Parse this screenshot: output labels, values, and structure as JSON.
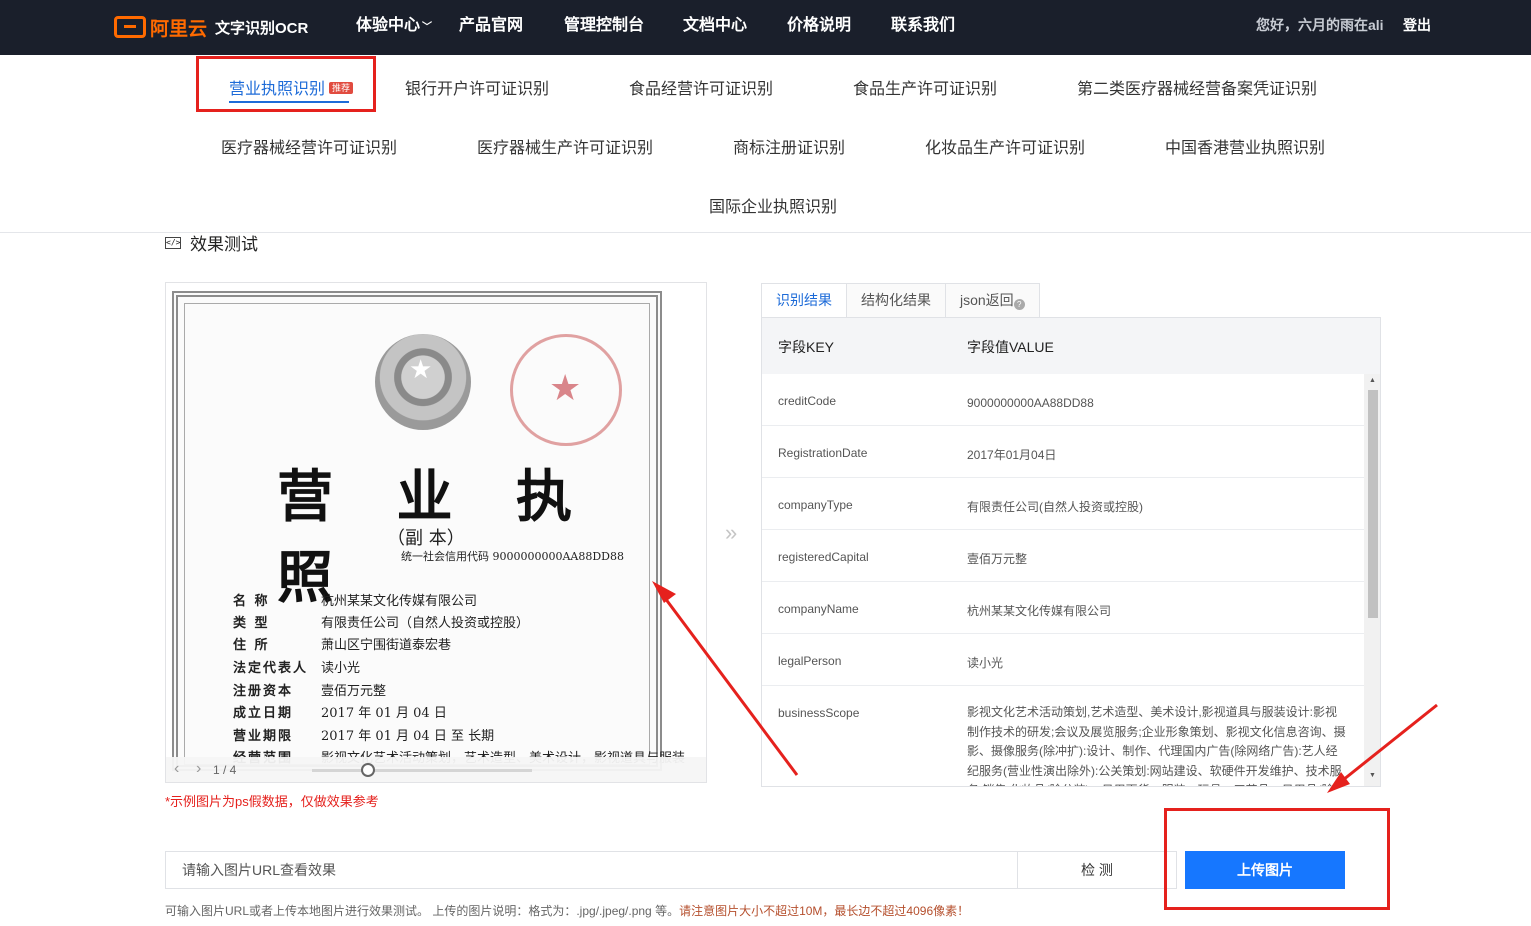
{
  "header": {
    "brand": "阿里云",
    "product": "文字识别OCR",
    "nav": [
      "体验中心",
      "产品官网",
      "管理控制台",
      "文档中心",
      "价格说明",
      "联系我们"
    ],
    "greeting": "您好，六月的雨在ali",
    "logout": "登出"
  },
  "tabs": {
    "row1": [
      "营业执照识别",
      "银行开户许可证识别",
      "食品经营许可证识别",
      "食品生产许可证识别",
      "第二类医疗器械经营备案凭证识别"
    ],
    "row2": [
      "医疗器械经营许可证识别",
      "医疗器械生产许可证识别",
      "商标注册证识别",
      "化妆品生产许可证识别",
      "中国香港营业执照识别"
    ],
    "row3": [
      "国际企业执照识别"
    ],
    "badge": "推荐"
  },
  "section_title": "效果测试",
  "license": {
    "title": "营 业 执 照",
    "subtitle": "（副 本）",
    "code": "统一社会信用代码 9000000000AA88DD88",
    "rows": [
      {
        "label": "名 称",
        "value": "杭州某某文化传媒有限公司"
      },
      {
        "label": "类 型",
        "value": "有限责任公司（自然人投资或控股）"
      },
      {
        "label": "住 所",
        "value": "萧山区宁围街道泰宏巷"
      },
      {
        "label": "法定代表人",
        "value": "读小光"
      },
      {
        "label": "注册资本",
        "value": "壹佰万元整"
      },
      {
        "label": "成立日期",
        "value": "2017 年 01 月 04 日"
      },
      {
        "label": "营业期限",
        "value": "2017 年 01 月 04 日 至 长期"
      },
      {
        "label": "经营范围",
        "value": "影视文化艺术活动策划，艺术造型、美术设计，影视道具与服装"
      }
    ]
  },
  "pager": {
    "text": "1 / 4"
  },
  "sample_note": "*示例图片为ps假数据，仅做效果参考",
  "result_tabs": [
    "识别结果",
    "结构化结果",
    "json返回"
  ],
  "result": {
    "head_key": "字段KEY",
    "head_value": "字段值VALUE",
    "rows": [
      {
        "key": "creditCode",
        "value": "9000000000AA88DD88"
      },
      {
        "key": "RegistrationDate",
        "value": "2017年01月04日"
      },
      {
        "key": "companyType",
        "value": "有限责任公司(自然人投资或控股)"
      },
      {
        "key": "registeredCapital",
        "value": "壹佰万元整"
      },
      {
        "key": "companyName",
        "value": "杭州某某文化传媒有限公司"
      },
      {
        "key": "legalPerson",
        "value": "读小光"
      },
      {
        "key": "businessScope",
        "value": "影视文化艺术活动策划,艺术造型、美术设计,影视道具与服装设计:影视制作技术的研发;会议及展览服务;企业形象策划、影视文化信息咨询、摄影、摄像服务(除冲扩):设计、制作、代理国内广告(除网络广告):艺人经纪服务(营业性演出除外):公关策划:网站建设、软硬件开发维护、技术服务;销售:化妆品(除分装)、日用百货、服装、玩具、工艺品、日用品(除金品药"
      }
    ]
  },
  "url_input": {
    "placeholder": "请输入图片URL查看效果"
  },
  "detect_button": "检 测",
  "upload_button": "上传图片",
  "hint": {
    "text": "可输入图片URL或者上传本地图片进行效果测试。 上传的图片说明：格式为：.jpg/.jpeg/.png 等。",
    "warn": "请注意图片大小不超过10M，最长边不超过4096像素！"
  },
  "colors": {
    "accent": "#1677ff",
    "annotation": "#e5211d",
    "brand": "#ff6a00",
    "topbar": "#1a1f2b"
  }
}
